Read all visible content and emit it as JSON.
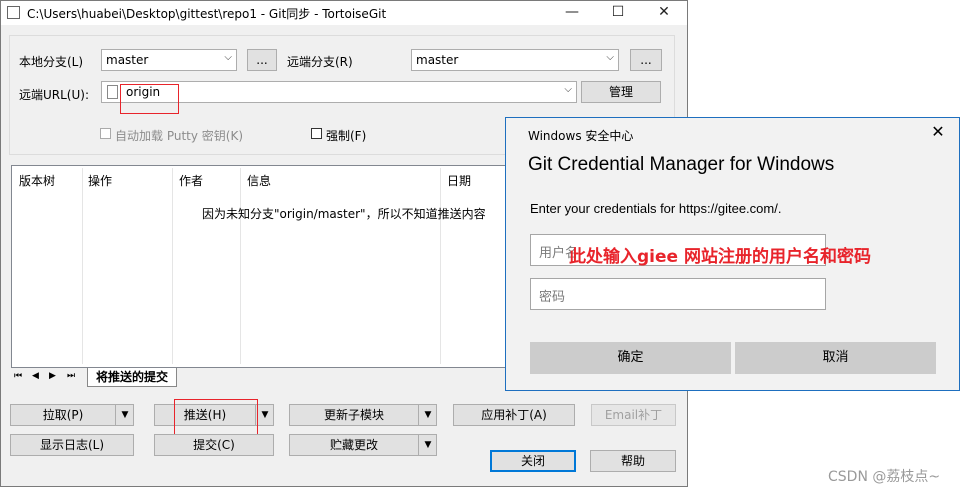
{
  "window": {
    "title": "C:\\Users\\huabei\\Desktop\\gittest\\repo1 - Git同步 - TortoiseGit",
    "controls": [
      "—",
      "☐",
      "✕"
    ]
  },
  "branch": {
    "local_label": "本地分支(L)",
    "local_value": "master",
    "remote_label": "远端分支(R)",
    "remote_value": "master",
    "browse": "...",
    "url_label": "远端URL(U):",
    "url_value": "origin",
    "manage": "管理",
    "autoload": "自动加载 Putty 密钥(K)",
    "force": "强制(F)"
  },
  "list": {
    "columns": [
      "版本树",
      "操作",
      "作者",
      "信息",
      "日期"
    ],
    "message": "因为未知分支\"origin/master\"，所以不知道推送内容"
  },
  "tabs": {
    "nav": [
      "⏮",
      "◀",
      "▶",
      "⏭"
    ],
    "active": "将推送的提交"
  },
  "buttons": {
    "pull": "拉取(P)",
    "push": "推送(H)",
    "update_submodule": "更新子模块",
    "apply_patch": "应用补丁(A)",
    "email_patch": "Email补丁",
    "show_log": "显示日志(L)",
    "commit": "提交(C)",
    "stash": "贮藏更改",
    "close": "关闭",
    "help": "帮助"
  },
  "dialog": {
    "window_title": "Windows 安全中心",
    "heading": "Git Credential Manager for Windows",
    "message": "Enter your credentials for https://gitee.com/.",
    "username_placeholder": "用户名",
    "password_placeholder": "密码",
    "ok": "确定",
    "cancel": "取消"
  },
  "annotation": "此处输入giee 网站注册的用户名和密码",
  "watermark": "CSDN @荔枝点~",
  "colors": {
    "accent": "#1e6fbf",
    "annotation": "#e8242b"
  }
}
